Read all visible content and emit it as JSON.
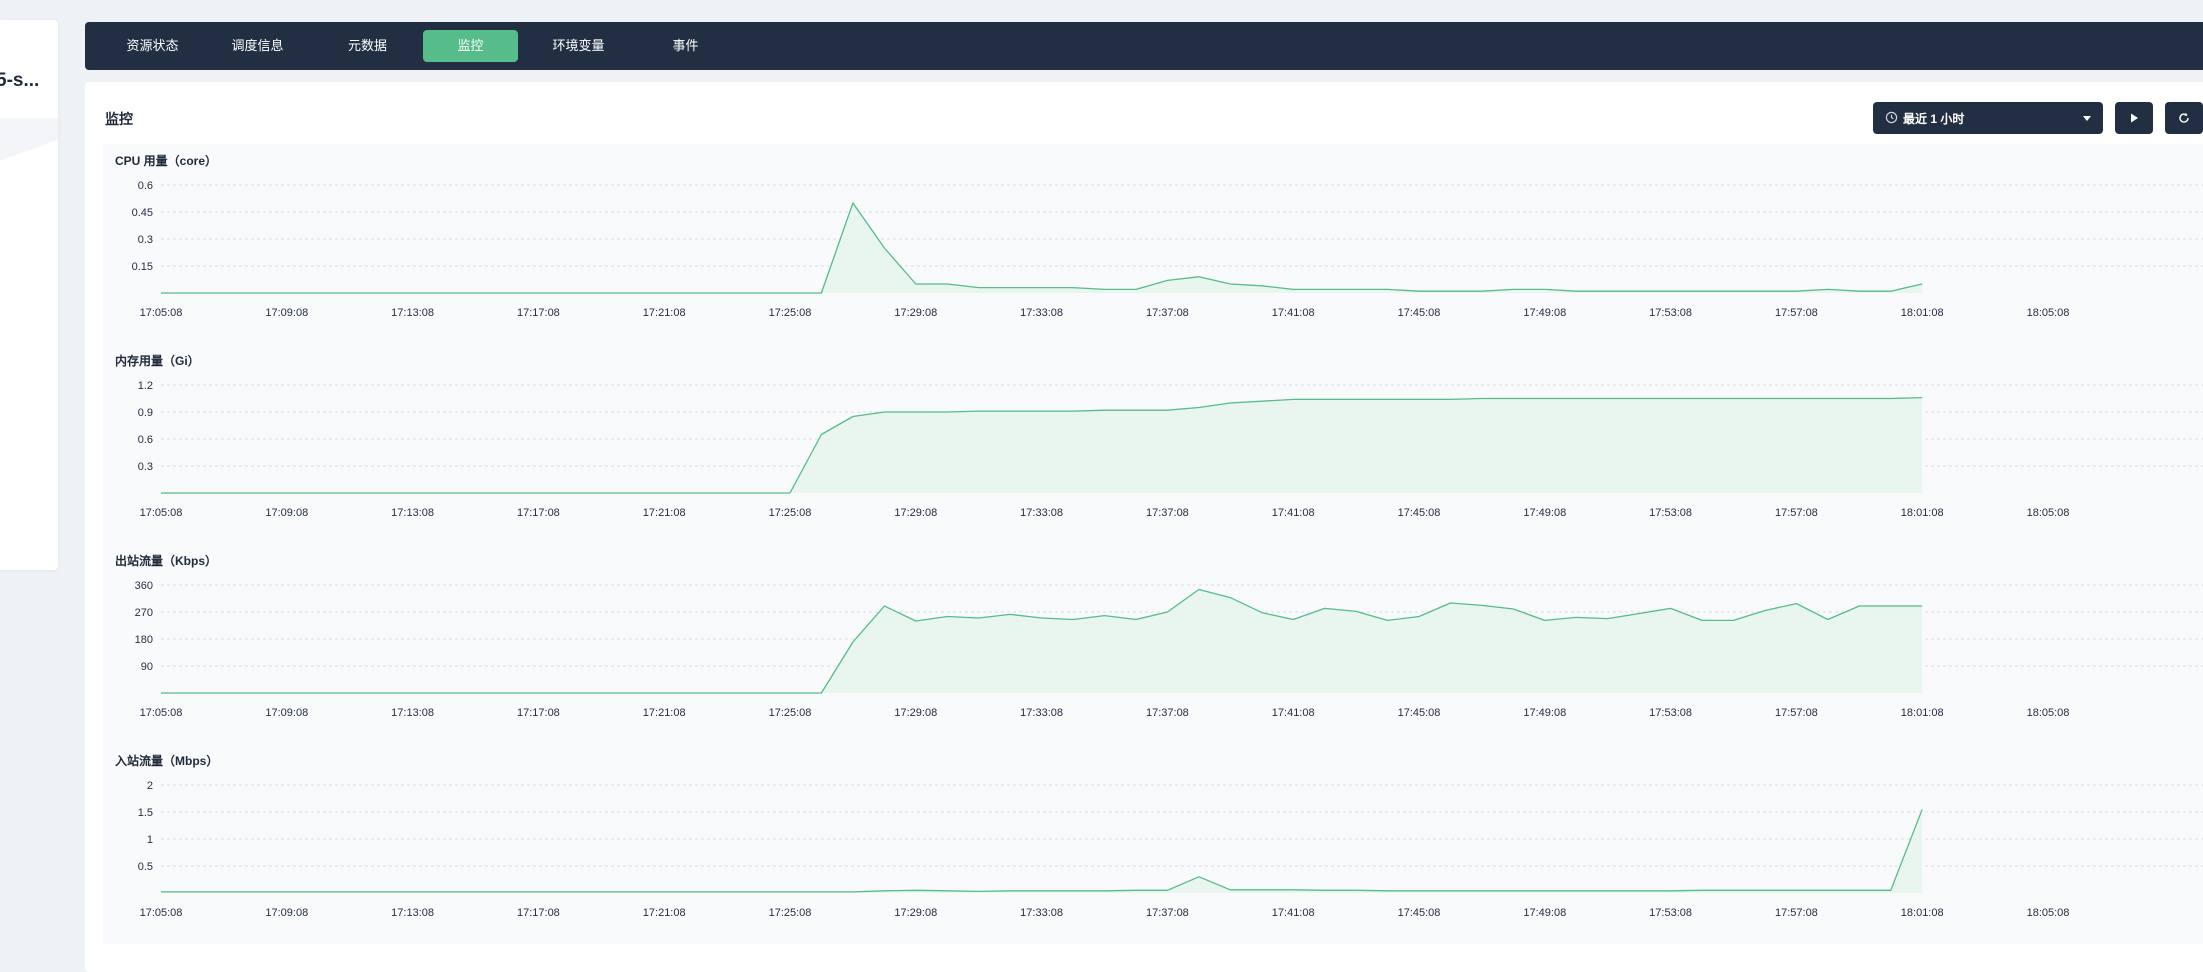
{
  "left_card": {
    "title": "5-s..."
  },
  "tabs": [
    {
      "label": "资源状态",
      "active": false
    },
    {
      "label": "调度信息",
      "active": false
    },
    {
      "label": "元数据",
      "active": false
    },
    {
      "label": "监控",
      "active": true
    },
    {
      "label": "环境变量",
      "active": false
    },
    {
      "label": "事件",
      "active": false
    }
  ],
  "panel": {
    "title": "监控",
    "time_range": {
      "value": "最近 1 小时",
      "icon": "clock-icon"
    },
    "buttons": [
      {
        "name": "play-button",
        "icon": "play-icon"
      },
      {
        "name": "refresh-button",
        "icon": "refresh-icon"
      }
    ]
  },
  "colors": {
    "accent": "#55bc8a",
    "dark": "#222f43",
    "line": "#55bc8a",
    "fill": "#e6f4ec"
  },
  "chart_data": [
    {
      "type": "area",
      "title": "CPU 用量（core）",
      "ylim": [
        0,
        0.6
      ],
      "yticks": [
        "0.6",
        "0.45",
        "0.3",
        "0.15"
      ],
      "xticks": [
        "17:05:08",
        "17:09:08",
        "17:13:08",
        "17:17:08",
        "17:21:08",
        "17:25:08",
        "17:29:08",
        "17:33:08",
        "17:37:08",
        "17:41:08",
        "17:45:08",
        "17:49:08",
        "17:53:08",
        "17:57:08",
        "18:01:08",
        "18:05:08"
      ],
      "x": [
        "17:05:08",
        "17:26:08",
        "17:27:08",
        "17:28:08",
        "17:29:08",
        "17:30:08",
        "17:31:08",
        "17:32:08",
        "17:33:08",
        "17:34:08",
        "17:35:08",
        "17:36:08",
        "17:37:08",
        "17:38:08",
        "17:39:08",
        "17:40:08",
        "17:41:08",
        "17:42:08",
        "17:43:08",
        "17:44:08",
        "17:45:08",
        "17:46:08",
        "17:47:08",
        "17:48:08",
        "17:49:08",
        "17:50:08",
        "17:51:08",
        "17:52:08",
        "17:53:08",
        "17:54:08",
        "17:55:08",
        "17:56:08",
        "17:57:08",
        "17:58:08",
        "17:59:08",
        "18:00:08",
        "18:01:08"
      ],
      "values": [
        0.0,
        0.0,
        0.5,
        0.25,
        0.05,
        0.05,
        0.03,
        0.03,
        0.03,
        0.03,
        0.02,
        0.02,
        0.07,
        0.09,
        0.05,
        0.04,
        0.02,
        0.02,
        0.02,
        0.02,
        0.01,
        0.01,
        0.01,
        0.02,
        0.02,
        0.01,
        0.01,
        0.01,
        0.01,
        0.01,
        0.01,
        0.01,
        0.01,
        0.02,
        0.01,
        0.01,
        0.05
      ]
    },
    {
      "type": "area",
      "title": "内存用量（Gi）",
      "ylim": [
        0,
        1.2
      ],
      "yticks": [
        "1.2",
        "0.9",
        "0.6",
        "0.3"
      ],
      "xticks": [
        "17:05:08",
        "17:09:08",
        "17:13:08",
        "17:17:08",
        "17:21:08",
        "17:25:08",
        "17:29:08",
        "17:33:08",
        "17:37:08",
        "17:41:08",
        "17:45:08",
        "17:49:08",
        "17:53:08",
        "17:57:08",
        "18:01:08",
        "18:05:08"
      ],
      "x": [
        "17:05:08",
        "17:25:08",
        "17:26:08",
        "17:27:08",
        "17:28:08",
        "17:29:08",
        "17:30:08",
        "17:31:08",
        "17:32:08",
        "17:33:08",
        "17:34:08",
        "17:35:08",
        "17:36:08",
        "17:37:08",
        "17:38:08",
        "17:39:08",
        "17:40:08",
        "17:41:08",
        "17:42:08",
        "17:43:08",
        "17:44:08",
        "17:45:08",
        "17:46:08",
        "17:47:08",
        "17:48:08",
        "17:49:08",
        "17:50:08",
        "17:51:08",
        "17:52:08",
        "17:53:08",
        "17:54:08",
        "17:55:08",
        "17:56:08",
        "17:57:08",
        "17:58:08",
        "17:59:08",
        "18:00:08",
        "18:01:08"
      ],
      "values": [
        0.0,
        0.0,
        0.65,
        0.85,
        0.9,
        0.9,
        0.9,
        0.91,
        0.91,
        0.91,
        0.91,
        0.92,
        0.92,
        0.92,
        0.95,
        1.0,
        1.02,
        1.04,
        1.04,
        1.04,
        1.04,
        1.04,
        1.04,
        1.05,
        1.05,
        1.05,
        1.05,
        1.05,
        1.05,
        1.05,
        1.05,
        1.05,
        1.05,
        1.05,
        1.05,
        1.05,
        1.05,
        1.06
      ]
    },
    {
      "type": "area",
      "title": "出站流量（Kbps）",
      "ylim": [
        0,
        360
      ],
      "yticks": [
        "360",
        "270",
        "180",
        "90"
      ],
      "xticks": [
        "17:05:08",
        "17:09:08",
        "17:13:08",
        "17:17:08",
        "17:21:08",
        "17:25:08",
        "17:29:08",
        "17:33:08",
        "17:37:08",
        "17:41:08",
        "17:45:08",
        "17:49:08",
        "17:53:08",
        "17:57:08",
        "18:01:08",
        "18:05:08"
      ],
      "x": [
        "17:05:08",
        "17:26:08",
        "17:27:08",
        "17:28:08",
        "17:29:08",
        "17:30:08",
        "17:31:08",
        "17:32:08",
        "17:33:08",
        "17:34:08",
        "17:35:08",
        "17:36:08",
        "17:37:08",
        "17:38:08",
        "17:39:08",
        "17:40:08",
        "17:41:08",
        "17:42:08",
        "17:43:08",
        "17:44:08",
        "17:45:08",
        "17:46:08",
        "17:47:08",
        "17:48:08",
        "17:49:08",
        "17:50:08",
        "17:51:08",
        "17:52:08",
        "17:53:08",
        "17:54:08",
        "17:55:08",
        "17:56:08",
        "17:57:08",
        "17:58:08",
        "17:59:08",
        "18:00:08",
        "18:01:08"
      ],
      "values": [
        0,
        0,
        170,
        290,
        240,
        255,
        250,
        262,
        250,
        245,
        258,
        245,
        270,
        345,
        318,
        268,
        245,
        282,
        272,
        242,
        255,
        300,
        292,
        280,
        242,
        252,
        248,
        265,
        282,
        242,
        242,
        275,
        298,
        245,
        290,
        290,
        290
      ]
    },
    {
      "type": "area",
      "title": "入站流量（Mbps）",
      "ylim": [
        0,
        2
      ],
      "yticks": [
        "2",
        "1.5",
        "1",
        "0.5"
      ],
      "xticks": [
        "17:05:08",
        "17:09:08",
        "17:13:08",
        "17:17:08",
        "17:21:08",
        "17:25:08",
        "17:29:08",
        "17:33:08",
        "17:37:08",
        "17:41:08",
        "17:45:08",
        "17:49:08",
        "17:53:08",
        "17:57:08",
        "18:01:08",
        "18:05:08"
      ],
      "x": [
        "17:05:08",
        "17:27:08",
        "17:28:08",
        "17:29:08",
        "17:30:08",
        "17:31:08",
        "17:32:08",
        "17:33:08",
        "17:34:08",
        "17:35:08",
        "17:36:08",
        "17:37:08",
        "17:38:08",
        "17:39:08",
        "17:40:08",
        "17:41:08",
        "17:42:08",
        "17:43:08",
        "17:44:08",
        "17:45:08",
        "17:46:08",
        "17:47:08",
        "17:48:08",
        "17:49:08",
        "17:50:08",
        "17:51:08",
        "17:52:08",
        "17:53:08",
        "17:54:08",
        "17:55:08",
        "17:56:08",
        "17:57:08",
        "17:58:08",
        "17:59:08",
        "18:00:08",
        "18:01:08"
      ],
      "values": [
        0.02,
        0.02,
        0.04,
        0.05,
        0.04,
        0.03,
        0.04,
        0.04,
        0.04,
        0.04,
        0.05,
        0.05,
        0.3,
        0.06,
        0.06,
        0.06,
        0.05,
        0.05,
        0.04,
        0.04,
        0.04,
        0.04,
        0.04,
        0.04,
        0.04,
        0.04,
        0.04,
        0.04,
        0.05,
        0.05,
        0.05,
        0.05,
        0.05,
        0.05,
        0.05,
        1.55
      ]
    }
  ]
}
